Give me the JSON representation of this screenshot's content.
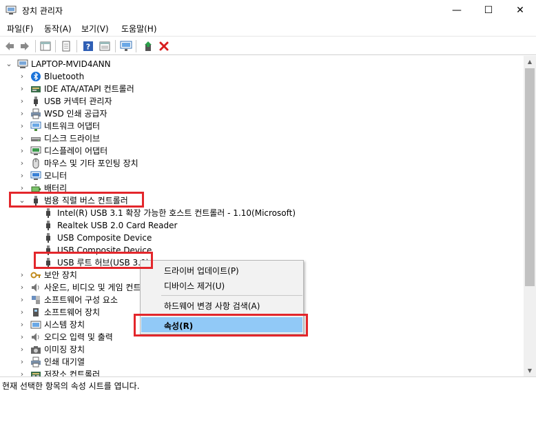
{
  "window": {
    "title": "장치 관리자",
    "controls": {
      "minimize": "—",
      "maximize": "☐",
      "close": "✕"
    }
  },
  "menu": [
    {
      "label": "파일(F)"
    },
    {
      "label": "동작(A)"
    },
    {
      "label": "보기(V)"
    },
    {
      "label": "도움말(H)"
    }
  ],
  "toolbar_icons": [
    "back-arrow-icon",
    "forward-arrow-icon",
    "properties-grid-icon",
    "document-icon",
    "help-icon",
    "properties-grid-icon",
    "monitor-scan-icon",
    "update-driver-icon",
    "uninstall-x-icon"
  ],
  "tree": {
    "root": "LAPTOP-MVID4ANN",
    "categories": [
      {
        "label": "Bluetooth",
        "icon": "bluetooth-icon"
      },
      {
        "label": "IDE ATA/ATAPI 컨트롤러",
        "icon": "ide-controller-icon"
      },
      {
        "label": "USB 커넥터 관리자",
        "icon": "usb-plug-icon"
      },
      {
        "label": "WSD 인쇄 공급자",
        "icon": "printer-icon"
      },
      {
        "label": "네트워크 어댑터",
        "icon": "network-adapter-icon"
      },
      {
        "label": "디스크 드라이브",
        "icon": "disk-drive-icon"
      },
      {
        "label": "디스플레이 어댑터",
        "icon": "display-adapter-icon"
      },
      {
        "label": "마우스 및 기타 포인팅 장치",
        "icon": "mouse-icon"
      },
      {
        "label": "모니터",
        "icon": "monitor-icon"
      },
      {
        "label": "배터리",
        "icon": "battery-icon"
      }
    ],
    "usb_category": {
      "label": "범용 직렬 버스 컨트롤러",
      "children": [
        {
          "label": "Intel(R) USB 3.1 확장 가능한 호스트 컨트롤러 - 1.10(Microsoft)"
        },
        {
          "label": "Realtek USB 2.0 Card Reader"
        },
        {
          "label": "USB Composite Device"
        },
        {
          "label": "USB Composite Device"
        },
        {
          "label": "USB 루트 허브(USB 3.0)"
        }
      ]
    },
    "more_categories": [
      {
        "label": "보안 장치",
        "icon": "security-key-icon"
      },
      {
        "label": "사운드, 비디오 및 게임 컨트롤러",
        "icon": "speaker-icon"
      },
      {
        "label": "소프트웨어 구성 요소",
        "icon": "software-component-icon"
      },
      {
        "label": "소프트웨어 장치",
        "icon": "software-device-icon"
      },
      {
        "label": "시스템 장치",
        "icon": "system-device-icon"
      },
      {
        "label": "오디오 입력 및 출력",
        "icon": "speaker-icon"
      },
      {
        "label": "이미징 장치",
        "icon": "camera-icon"
      },
      {
        "label": "인쇄 대기열",
        "icon": "printer-icon"
      },
      {
        "label": "저장소 컨트롤러",
        "icon": "storage-controller-icon"
      }
    ]
  },
  "context_menu": {
    "items": [
      {
        "label": "드라이버 업데이트(P)"
      },
      {
        "label": "디바이스 제거(U)"
      },
      {
        "label": "하드웨어 변경 사항 검색(A)"
      },
      {
        "label": "속성(R)"
      }
    ]
  },
  "status": "현재 선택한 항목의 속성 시트를 엽니다.",
  "colors": {
    "highlight": "#91c9f7",
    "annotation_red": "#e3262b"
  }
}
